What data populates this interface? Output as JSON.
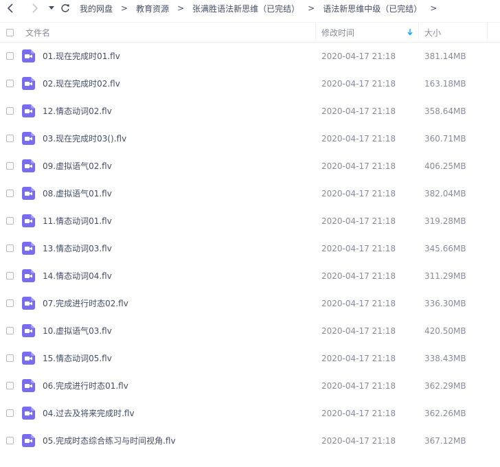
{
  "toolbar": {
    "back_icon": "chevron-left-icon",
    "forward_icon": "chevron-right-icon",
    "history_icon": "caret-down-icon",
    "refresh_icon": "refresh-icon"
  },
  "breadcrumbs": [
    "我的网盘",
    "教育资源",
    "张满胜语法新思维（已完结）",
    "语法新思维中级（已完结）"
  ],
  "breadcrumb_separator": ">",
  "header": {
    "name": "文件名",
    "modified": "修改时间",
    "size": "大小",
    "sort_icon": "arrow-down-icon"
  },
  "colors": {
    "text": "#424e67",
    "muted": "#878c9c",
    "accent": "#06a7ff",
    "file_icon": "#7a6cf0"
  },
  "files": [
    {
      "name": "01.现在完成时01.flv",
      "modified": "2020-04-17 21:18",
      "size": "381.14MB",
      "icon": "video-file-icon"
    },
    {
      "name": "02.现在完成时02.flv",
      "modified": "2020-04-17 21:18",
      "size": "163.18MB",
      "icon": "video-file-icon"
    },
    {
      "name": "12.情态动词02.flv",
      "modified": "2020-04-17 21:18",
      "size": "358.64MB",
      "icon": "video-file-icon"
    },
    {
      "name": "03.现在完成时03().flv",
      "modified": "2020-04-17 21:18",
      "size": "360.71MB",
      "icon": "video-file-icon"
    },
    {
      "name": "09.虚拟语气02.flv",
      "modified": "2020-04-17 21:18",
      "size": "406.25MB",
      "icon": "video-file-icon"
    },
    {
      "name": "08.虚拟语气01.flv",
      "modified": "2020-04-17 21:18",
      "size": "382.04MB",
      "icon": "video-file-icon"
    },
    {
      "name": "11.情态动词01.flv",
      "modified": "2020-04-17 21:18",
      "size": "319.28MB",
      "icon": "video-file-icon"
    },
    {
      "name": "13.情态动词03.flv",
      "modified": "2020-04-17 21:18",
      "size": "345.66MB",
      "icon": "video-file-icon"
    },
    {
      "name": "14.情态动词04.flv",
      "modified": "2020-04-17 21:18",
      "size": "311.29MB",
      "icon": "video-file-icon"
    },
    {
      "name": "07.完成进行时态02.flv",
      "modified": "2020-04-17 21:18",
      "size": "336.30MB",
      "icon": "video-file-icon"
    },
    {
      "name": "10.虚拟语气03.flv",
      "modified": "2020-04-17 21:18",
      "size": "420.50MB",
      "icon": "video-file-icon"
    },
    {
      "name": "15.情态动词05.flv",
      "modified": "2020-04-17 21:18",
      "size": "338.43MB",
      "icon": "video-file-icon"
    },
    {
      "name": "06.完成进行时态01.flv",
      "modified": "2020-04-17 21:18",
      "size": "362.29MB",
      "icon": "video-file-icon"
    },
    {
      "name": "04.过去及将来完成时.flv",
      "modified": "2020-04-17 21:18",
      "size": "362.26MB",
      "icon": "video-file-icon"
    },
    {
      "name": "05.完成时态综合练习与时间视角.flv",
      "modified": "2020-04-17 21:18",
      "size": "367.12MB",
      "icon": "video-file-icon"
    }
  ]
}
